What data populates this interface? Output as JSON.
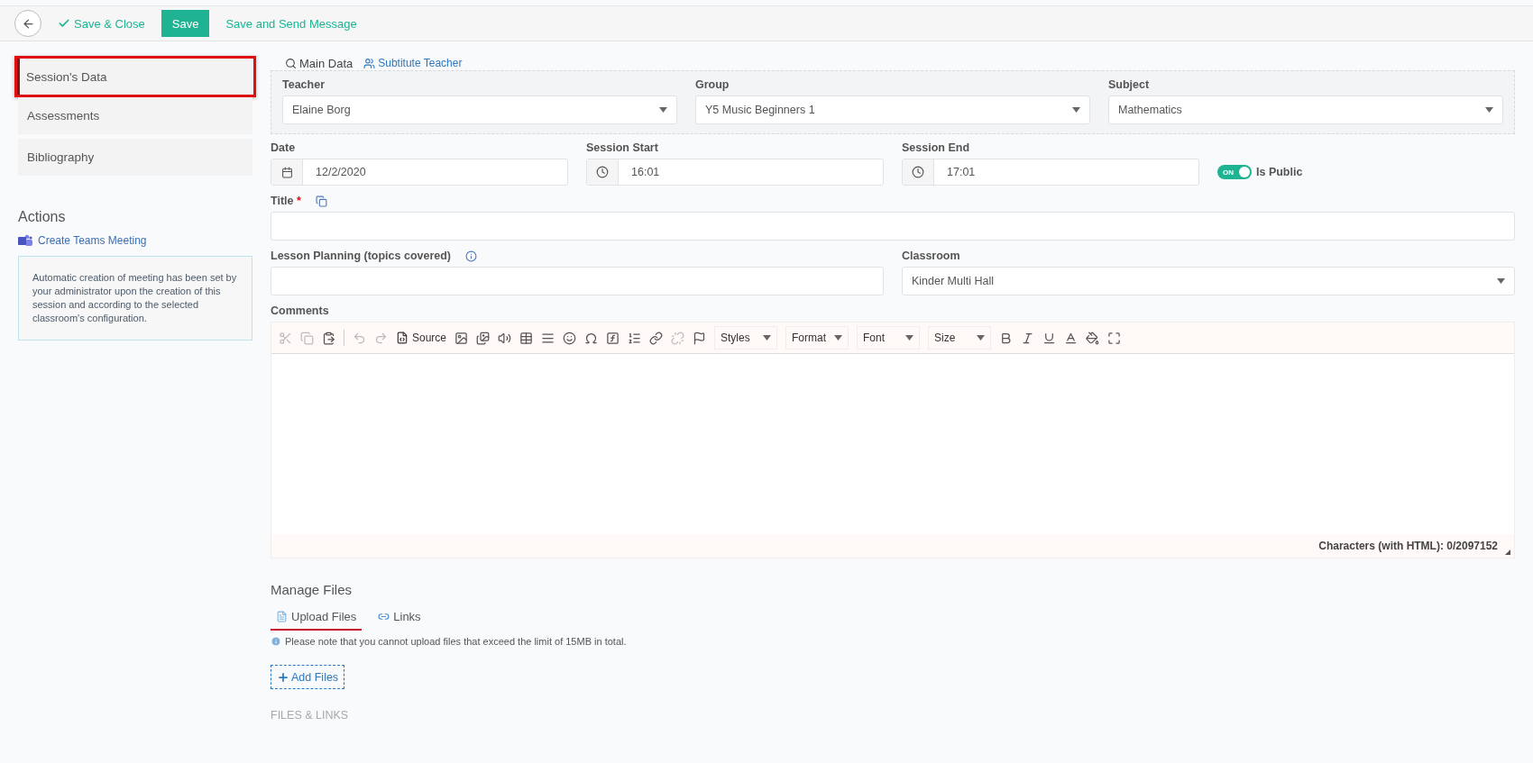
{
  "toolbar": {
    "buttons": [
      {
        "label": "Save & Close",
        "kind": "check"
      },
      {
        "label": "Save",
        "kind": "primary"
      },
      {
        "label": "Save and Send Message",
        "kind": "link"
      }
    ]
  },
  "sidebar": {
    "items": [
      {
        "label": "Session's Data",
        "selected": true
      },
      {
        "label": "Assessments",
        "selected": false
      },
      {
        "label": "Bibliography",
        "selected": false
      }
    ]
  },
  "actions": {
    "title": "Actions",
    "link": "Create Teams Meeting",
    "note": "Automatic creation of meeting has been set by your administrator upon the creation of this session and according to the selected classroom's configuration."
  },
  "form_tabs": [
    {
      "label": "Main Data",
      "kind": "search",
      "selected": true
    },
    {
      "label": "Subtitute Teacher",
      "kind": "person",
      "selected": false
    }
  ],
  "main_data": [
    {
      "label": "Teacher",
      "value": "Elaine Borg"
    },
    {
      "label": "Group",
      "value": "Y5 Music Beginners 1"
    },
    {
      "label": "Subject",
      "value": "Mathematics"
    }
  ],
  "schedule": [
    {
      "label": "Date",
      "value": "12/2/2020",
      "kind": "date"
    },
    {
      "label": "Session Start",
      "value": "16:01",
      "kind": "time"
    },
    {
      "label": "Session End",
      "value": "17:01",
      "kind": "time"
    }
  ],
  "is_public": {
    "label": "Is Public",
    "on": true,
    "state_text": "ON"
  },
  "title_field": {
    "label": "Title",
    "required_mark": "*"
  },
  "lesson_planning": {
    "label": "Lesson Planning (topics covered)"
  },
  "classroom": {
    "label": "Classroom",
    "value": "Kinder Multi Hall"
  },
  "comments": {
    "label": "Comments",
    "source": "Source",
    "dropdowns": [
      "Styles",
      "Format",
      "Font",
      "Size"
    ],
    "counter": "Characters (with HTML): 0/2097152"
  },
  "manage_files": {
    "title": "Manage Files",
    "tabs": [
      {
        "label": "Upload Files",
        "selected": true
      },
      {
        "label": "Links",
        "selected": false
      }
    ],
    "note": "Please note that you cannot upload files that exceed the limit of 15MB in total.",
    "add_button": "Add Files",
    "section": "FILES & LINKS"
  }
}
